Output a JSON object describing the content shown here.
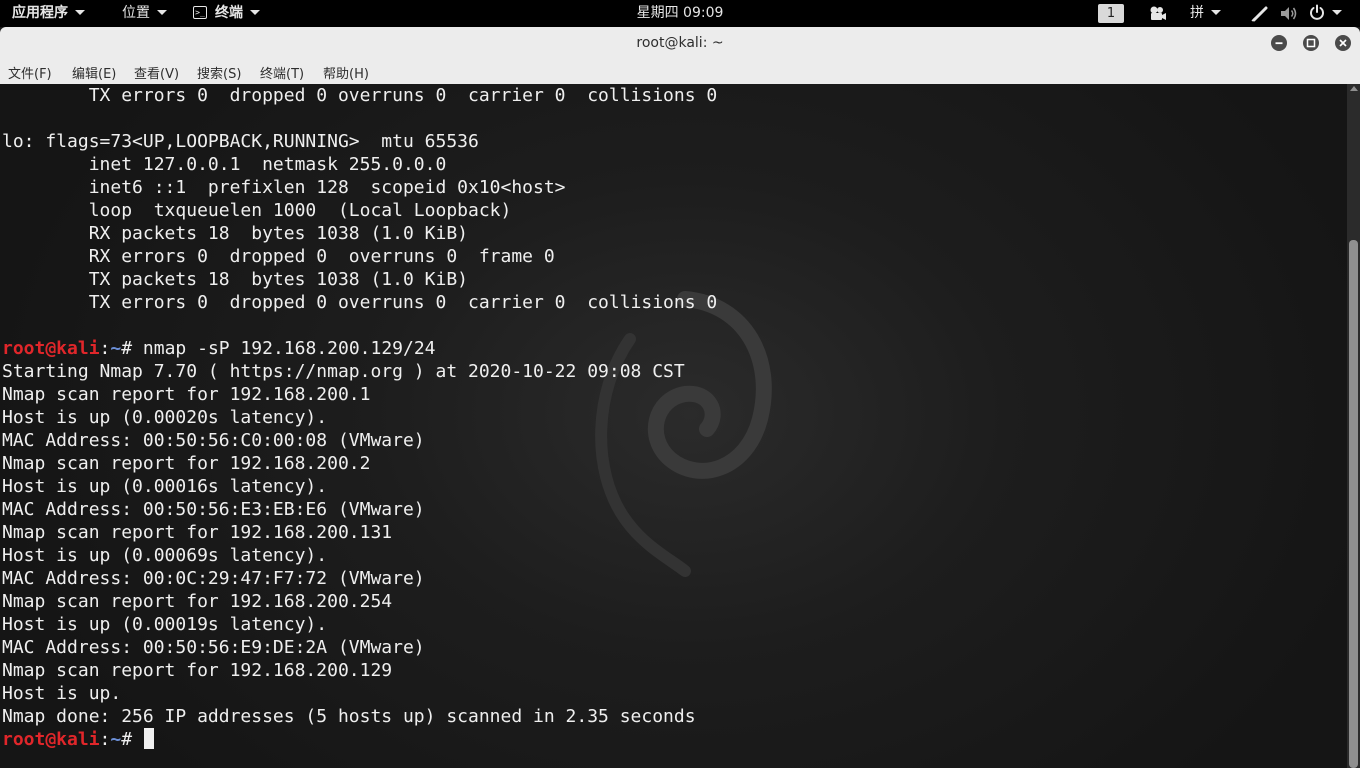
{
  "top_panel": {
    "applications": "应用程序",
    "places": "位置",
    "terminal": "终端",
    "clock": "星期四 09:09",
    "workspace": "1",
    "input_method": "拼"
  },
  "window": {
    "title": "root@kali: ~",
    "menu": [
      "文件(F)",
      "编辑(E)",
      "查看(V)",
      "搜索(S)",
      "终端(T)",
      "帮助(H)"
    ]
  },
  "terminal": {
    "prompt": {
      "user": "root@kali",
      "sep": ":",
      "path": "~",
      "symbol": "# "
    },
    "lines": [
      {
        "text": "        TX errors 0  dropped 0 overruns 0  carrier 0  collisions 0"
      },
      {
        "text": ""
      },
      {
        "text": "lo: flags=73<UP,LOOPBACK,RUNNING>  mtu 65536"
      },
      {
        "text": "        inet 127.0.0.1  netmask 255.0.0.0"
      },
      {
        "text": "        inet6 ::1  prefixlen 128  scopeid 0x10<host>"
      },
      {
        "text": "        loop  txqueuelen 1000  (Local Loopback)"
      },
      {
        "text": "        RX packets 18  bytes 1038 (1.0 KiB)"
      },
      {
        "text": "        RX errors 0  dropped 0  overruns 0  frame 0"
      },
      {
        "text": "        TX packets 18  bytes 1038 (1.0 KiB)"
      },
      {
        "text": "        TX errors 0  dropped 0 overruns 0  carrier 0  collisions 0"
      },
      {
        "text": ""
      },
      {
        "prompt": true,
        "text": "nmap -sP 192.168.200.129/24"
      },
      {
        "text": "Starting Nmap 7.70 ( https://nmap.org ) at 2020-10-22 09:08 CST"
      },
      {
        "text": "Nmap scan report for 192.168.200.1"
      },
      {
        "text": "Host is up (0.00020s latency)."
      },
      {
        "text": "MAC Address: 00:50:56:C0:00:08 (VMware)"
      },
      {
        "text": "Nmap scan report for 192.168.200.2"
      },
      {
        "text": "Host is up (0.00016s latency)."
      },
      {
        "text": "MAC Address: 00:50:56:E3:EB:E6 (VMware)"
      },
      {
        "text": "Nmap scan report for 192.168.200.131"
      },
      {
        "text": "Host is up (0.00069s latency)."
      },
      {
        "text": "MAC Address: 00:0C:29:47:F7:72 (VMware)"
      },
      {
        "text": "Nmap scan report for 192.168.200.254"
      },
      {
        "text": "Host is up (0.00019s latency)."
      },
      {
        "text": "MAC Address: 00:50:56:E9:DE:2A (VMware)"
      },
      {
        "text": "Nmap scan report for 192.168.200.129"
      },
      {
        "text": "Host is up."
      },
      {
        "text": "Nmap done: 256 IP addresses (5 hosts up) scanned in 2.35 seconds"
      },
      {
        "prompt": true,
        "text": "",
        "cursor": true
      }
    ]
  },
  "colors": {
    "prompt_user": "#e0262a",
    "prompt_path": "#6b8fd6",
    "terminal_text": "#efefef",
    "panel_bg": "#000000",
    "titlebar_bg": "#ececec"
  },
  "icons": [
    "terminal-icon",
    "camera-icon",
    "pen-icon",
    "volume-icon",
    "power-icon",
    "minimize-icon",
    "maximize-icon",
    "close-icon",
    "debian-swirl-icon"
  ]
}
